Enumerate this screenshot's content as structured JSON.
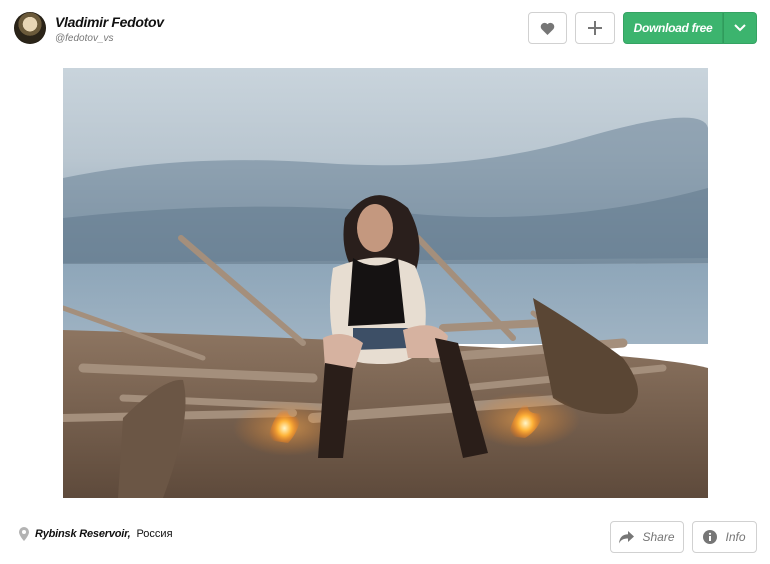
{
  "author": {
    "name": "Vladimir Fedotov",
    "handle": "@fedotov_vs"
  },
  "actions": {
    "like_icon": "heart-icon",
    "collect_icon": "plus-icon",
    "download_label": "Download free",
    "download_menu_icon": "chevron-down-icon"
  },
  "location": {
    "icon": "map-pin-icon",
    "name": "Rybinsk Reservoir,",
    "country": "Россия"
  },
  "footer": {
    "share_label": "Share",
    "info_label": "Info"
  },
  "colors": {
    "accent": "#3cb46e",
    "muted": "#767676",
    "border": "#d1d1d1"
  }
}
